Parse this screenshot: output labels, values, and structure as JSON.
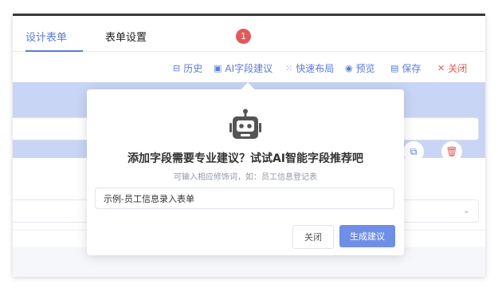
{
  "tabs": [
    {
      "label": "设计表单",
      "active": true
    },
    {
      "label": "表单设置",
      "active": false
    }
  ],
  "toolbar": {
    "badge": "1",
    "items": [
      {
        "icon": "history-icon",
        "glyph": "⊟",
        "label": "历史"
      },
      {
        "icon": "robot-icon",
        "glyph": "▣",
        "label": "AI字段建议"
      },
      {
        "icon": "sparkle-icon",
        "glyph": "⁙",
        "label": "快速布局"
      },
      {
        "icon": "eye-icon",
        "glyph": "◉",
        "label": "预览"
      },
      {
        "icon": "save-icon",
        "glyph": "▤",
        "label": "保存"
      },
      {
        "icon": "close-icon",
        "glyph": "✕",
        "label": "关闭"
      }
    ]
  },
  "popover": {
    "title": "添加字段需要专业建议？试试AI智能字段推荐吧",
    "subtitle": "可输入相应修饰词，如：员工信息登记表",
    "input_value": "示例-员工信息录入表单",
    "close_label": "关闭",
    "generate_label": "生成建议"
  },
  "colors": {
    "accent": "#5b7bd6",
    "danger": "#e05a5a",
    "band": "#c9d5f5",
    "primary_button": "#6f8fe6"
  }
}
